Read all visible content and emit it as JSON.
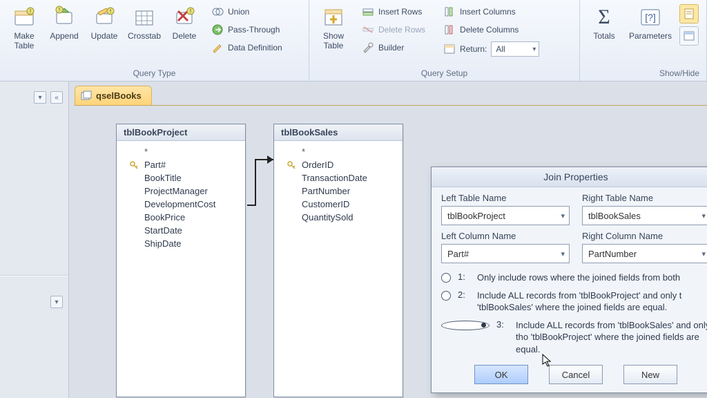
{
  "ribbon": {
    "query_type": {
      "label": "Query Type",
      "make_table": "Make\nTable",
      "append": "Append",
      "update": "Update",
      "crosstab": "Crosstab",
      "delete": "Delete",
      "union": "Union",
      "passthrough": "Pass-Through",
      "datadef": "Data Definition"
    },
    "query_setup": {
      "label": "Query Setup",
      "show_table": "Show\nTable",
      "insert_rows": "Insert Rows",
      "delete_rows": "Delete Rows",
      "builder": "Builder",
      "insert_cols": "Insert Columns",
      "delete_cols": "Delete Columns",
      "return": "Return:",
      "return_value": "All"
    },
    "show_hide": {
      "label": "Show/Hide",
      "totals": "Totals",
      "parameters": "Parameters"
    }
  },
  "tab": {
    "title": "qselBooks"
  },
  "tables": {
    "left": {
      "title": "tblBookProject",
      "fields": [
        "*",
        "Part#",
        "BookTitle",
        "ProjectManager",
        "DevelopmentCost",
        "BookPrice",
        "StartDate",
        "ShipDate"
      ],
      "key_index": 1
    },
    "right": {
      "title": "tblBookSales",
      "fields": [
        "*",
        "OrderID",
        "TransactionDate",
        "PartNumber",
        "CustomerID",
        "QuantitySold"
      ],
      "key_index": 1
    }
  },
  "dialog": {
    "title": "Join Properties",
    "left_table_label": "Left Table Name",
    "right_table_label": "Right Table Name",
    "left_column_label": "Left Column Name",
    "right_column_label": "Right Column Name",
    "left_table": "tblBookProject",
    "right_table": "tblBookSales",
    "left_column": "Part#",
    "right_column": "PartNumber",
    "options": [
      {
        "num": "1:",
        "text": "Only include rows where the joined fields from both"
      },
      {
        "num": "2:",
        "text": "Include ALL records from 'tblBookProject' and only t 'tblBookSales' where the joined fields are equal."
      },
      {
        "num": "3:",
        "text": "Include ALL records from 'tblBookSales' and only tho 'tblBookProject' where the joined fields are equal."
      }
    ],
    "selected": 2,
    "ok": "OK",
    "cancel": "Cancel",
    "new": "New"
  }
}
